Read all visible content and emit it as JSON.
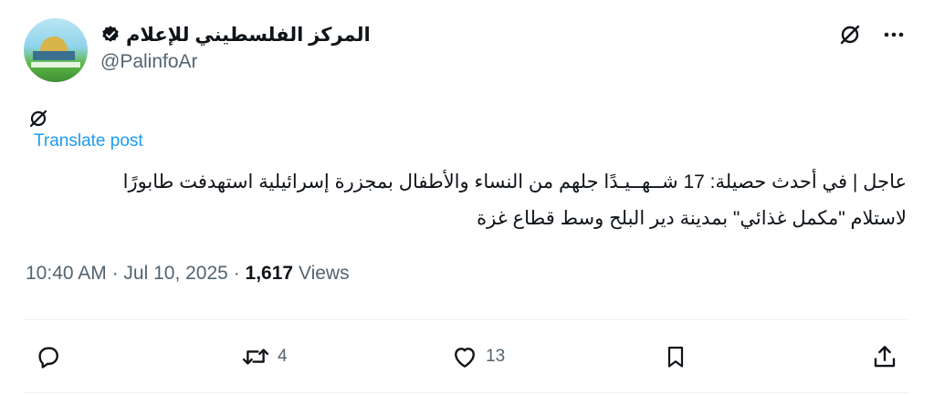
{
  "author": {
    "display_name": "المركز الفلسطيني للإعلام",
    "handle": "@PalinfoAr",
    "verified": true
  },
  "header_actions": {
    "grok_icon": "grok-icon",
    "more_icon": "more-horizontal-icon"
  },
  "post": {
    "translate_label": "Translate post",
    "text_lines": [
      "عاجل | في أحدث حصيلة: 17 شــهــيـدًا جلهم من النساء والأطفال بمجزرة إسرائيلية استهدفت طابورًا",
      "لاستلام \"مكمل غذائي\" بمدينة دير البلح وسط قطاع غزة"
    ]
  },
  "meta": {
    "time": "10:40 AM",
    "separator": "·",
    "date": "Jul 10, 2025",
    "separator2": "·",
    "views_count": "1,617",
    "views_label": "Views"
  },
  "actions": {
    "reply_count": "",
    "repost_count": "4",
    "like_count": "13",
    "bookmark_count": "",
    "share_icon": "share-icon"
  },
  "colors": {
    "accent": "#1d9bf0",
    "text_primary": "#0f1419",
    "text_secondary": "#536471",
    "divider": "#eff3f4"
  }
}
